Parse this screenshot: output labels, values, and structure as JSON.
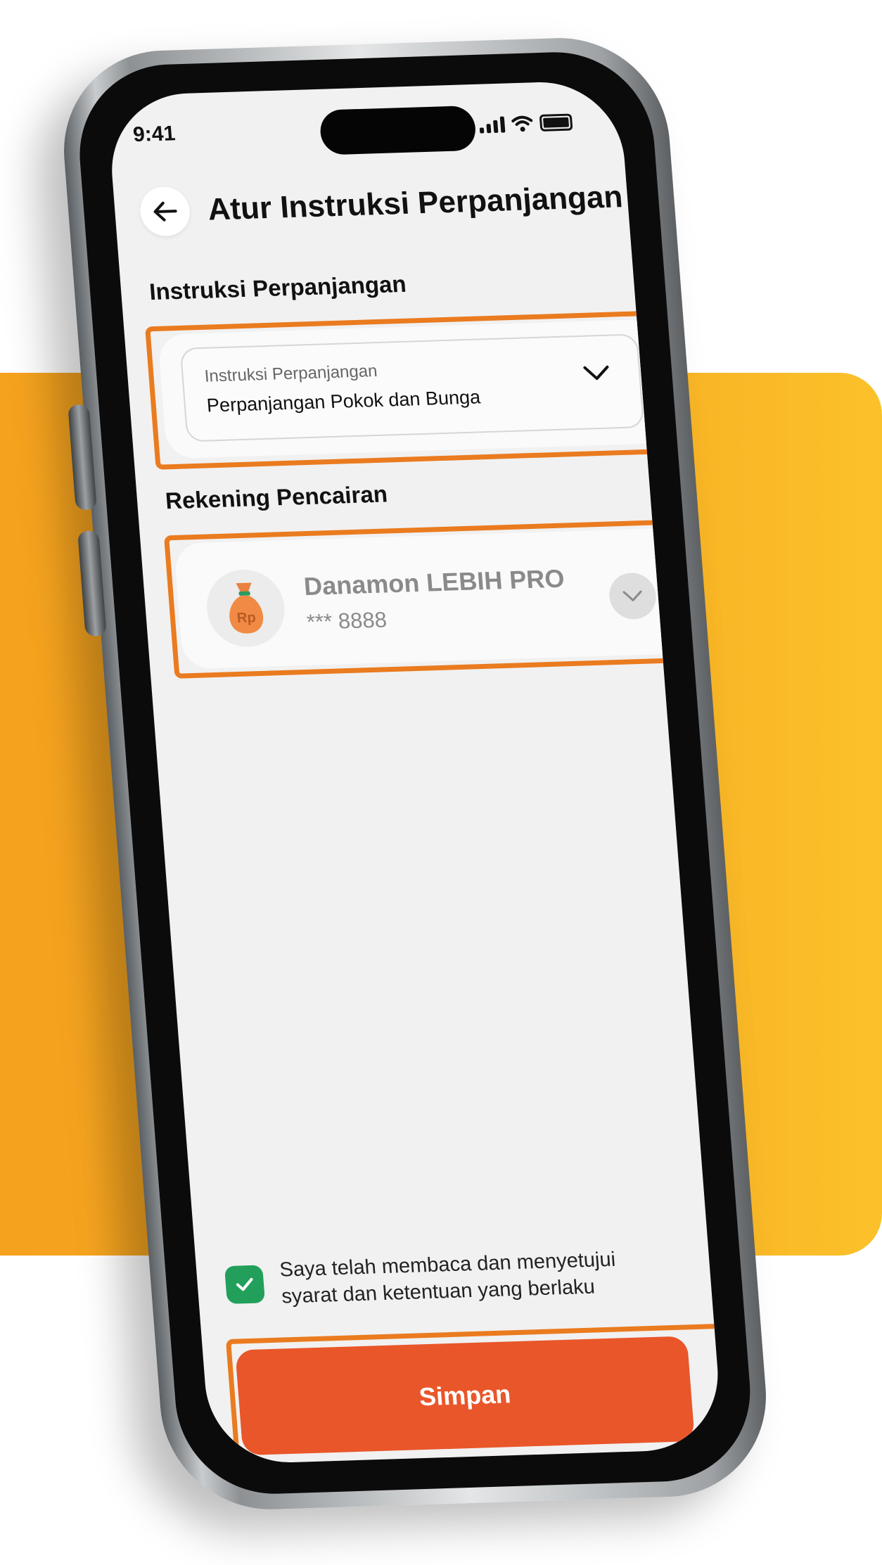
{
  "status_bar": {
    "time": "9:41"
  },
  "header": {
    "title": "Atur Instruksi Perpanjangan"
  },
  "instruction_section": {
    "heading": "Instruksi Perpanjangan",
    "dropdown_label": "Instruksi Perpanjangan",
    "dropdown_value": "Perpanjangan Pokok dan Bunga"
  },
  "account_section": {
    "heading": "Rekening Pencairan",
    "account_name": "Danamon LEBIH PRO",
    "account_number": "*** 8888",
    "avatar_text": "Rp"
  },
  "agreement": {
    "text": "Saya telah membaca dan menyetujui syarat dan ketentuan yang berlaku",
    "checked": true
  },
  "save_button": {
    "label": "Simpan"
  },
  "colors": {
    "accent": "#ea7b1f",
    "primary_button": "#e9562a",
    "checkbox": "#22a05b",
    "background_band": "#f5a21e"
  }
}
